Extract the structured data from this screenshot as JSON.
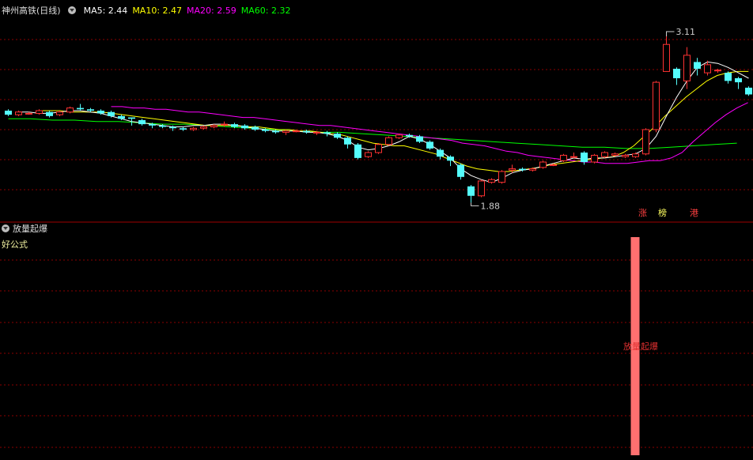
{
  "header": {
    "stock_name": "神州高铁",
    "period": "(日线)",
    "ma": [
      {
        "label": "MA5:",
        "value": "2.44",
        "color": "#ffffff"
      },
      {
        "label": "MA10:",
        "value": "2.47",
        "color": "#ffff00"
      },
      {
        "label": "MA20:",
        "value": "2.59",
        "color": "#ff00ff"
      },
      {
        "label": "MA60:",
        "value": "2.32",
        "color": "#00ff00"
      }
    ]
  },
  "tags": [
    "涨",
    "榜",
    "港"
  ],
  "indicator": {
    "name": "放量起爆",
    "formula_label": "好公式",
    "signal_text": "放量起爆"
  },
  "colors": {
    "up": "#ff3232",
    "down": "#54fcfc",
    "ma5": "#ffffff",
    "ma10": "#ffff00",
    "ma20": "#ff00ff",
    "ma60": "#00ff00",
    "grid": "#8b0000",
    "signal_bar": "#ff7070"
  },
  "chart_data": {
    "type": "candlestick",
    "high_label": "3.11",
    "low_label": "1.88",
    "y_range": [
      1.8,
      3.25
    ],
    "candles": [
      [
        2.56,
        2.53,
        2.57,
        2.52
      ],
      [
        2.53,
        2.55,
        2.56,
        2.52
      ],
      [
        2.54,
        2.54,
        2.55,
        2.53
      ],
      [
        2.54,
        2.56,
        2.57,
        2.53
      ],
      [
        2.55,
        2.52,
        2.56,
        2.51
      ],
      [
        2.53,
        2.55,
        2.56,
        2.52
      ],
      [
        2.55,
        2.58,
        2.59,
        2.54
      ],
      [
        2.58,
        2.57,
        2.61,
        2.56
      ],
      [
        2.57,
        2.56,
        2.58,
        2.55
      ],
      [
        2.56,
        2.54,
        2.57,
        2.53
      ],
      [
        2.55,
        2.52,
        2.56,
        2.51
      ],
      [
        2.52,
        2.5,
        2.53,
        2.49
      ],
      [
        2.51,
        2.5,
        2.51,
        2.45
      ],
      [
        2.49,
        2.46,
        2.5,
        2.45
      ],
      [
        2.46,
        2.45,
        2.47,
        2.43
      ],
      [
        2.45,
        2.44,
        2.46,
        2.43
      ],
      [
        2.44,
        2.43,
        2.45,
        2.41
      ],
      [
        2.43,
        2.42,
        2.44,
        2.41
      ],
      [
        2.42,
        2.43,
        2.44,
        2.41
      ],
      [
        2.43,
        2.44,
        2.45,
        2.42
      ],
      [
        2.44,
        2.45,
        2.46,
        2.43
      ],
      [
        2.46,
        2.46,
        2.48,
        2.44
      ],
      [
        2.46,
        2.44,
        2.47,
        2.43
      ],
      [
        2.45,
        2.43,
        2.46,
        2.42
      ],
      [
        2.44,
        2.42,
        2.45,
        2.41
      ],
      [
        2.42,
        2.41,
        2.43,
        2.4
      ],
      [
        2.41,
        2.4,
        2.42,
        2.39
      ],
      [
        2.4,
        2.41,
        2.42,
        2.38
      ],
      [
        2.41,
        2.41,
        2.42,
        2.4
      ],
      [
        2.41,
        2.4,
        2.42,
        2.39
      ],
      [
        2.4,
        2.4,
        2.41,
        2.38
      ],
      [
        2.4,
        2.39,
        2.41,
        2.37
      ],
      [
        2.39,
        2.36,
        2.4,
        2.35
      ],
      [
        2.36,
        2.31,
        2.37,
        2.28
      ],
      [
        2.31,
        2.21,
        2.32,
        2.2
      ],
      [
        2.22,
        2.25,
        2.26,
        2.21
      ],
      [
        2.25,
        2.31,
        2.32,
        2.24
      ],
      [
        2.31,
        2.36,
        2.37,
        2.3
      ],
      [
        2.36,
        2.38,
        2.39,
        2.35
      ],
      [
        2.38,
        2.37,
        2.39,
        2.36
      ],
      [
        2.37,
        2.33,
        2.38,
        2.32
      ],
      [
        2.33,
        2.28,
        2.34,
        2.27
      ],
      [
        2.27,
        2.22,
        2.28,
        2.2
      ],
      [
        2.22,
        2.19,
        2.23,
        2.15
      ],
      [
        2.16,
        2.07,
        2.17,
        2.05
      ],
      [
        2.0,
        1.93,
        2.01,
        1.88
      ],
      [
        1.93,
        2.04,
        2.05,
        1.92
      ],
      [
        2.03,
        2.05,
        2.06,
        2.02
      ],
      [
        2.03,
        2.11,
        2.12,
        2.02
      ],
      [
        2.12,
        2.13,
        2.16,
        2.1
      ],
      [
        2.13,
        2.12,
        2.14,
        2.11
      ],
      [
        2.12,
        2.13,
        2.14,
        2.11
      ],
      [
        2.14,
        2.18,
        2.19,
        2.13
      ],
      [
        2.16,
        2.16,
        2.17,
        2.15
      ],
      [
        2.19,
        2.23,
        2.24,
        2.18
      ],
      [
        2.22,
        2.22,
        2.25,
        2.21
      ],
      [
        2.25,
        2.18,
        2.26,
        2.16
      ],
      [
        2.18,
        2.23,
        2.24,
        2.17
      ],
      [
        2.22,
        2.25,
        2.26,
        2.21
      ],
      [
        2.23,
        2.24,
        2.25,
        2.22
      ],
      [
        2.22,
        2.23,
        2.24,
        2.21
      ],
      [
        2.22,
        2.24,
        2.25,
        2.21
      ],
      [
        2.24,
        2.42,
        2.43,
        2.23
      ],
      [
        2.42,
        2.77,
        2.78,
        2.4
      ],
      [
        2.85,
        3.05,
        3.11,
        2.85
      ],
      [
        2.87,
        2.8,
        2.88,
        2.75
      ],
      [
        2.78,
        2.97,
        3.03,
        2.72
      ],
      [
        2.92,
        2.87,
        2.95,
        2.82
      ],
      [
        2.84,
        2.9,
        2.93,
        2.82
      ],
      [
        2.86,
        2.86,
        2.87,
        2.84
      ],
      [
        2.84,
        2.78,
        2.85,
        2.76
      ],
      [
        2.8,
        2.77,
        2.81,
        2.72
      ],
      [
        2.73,
        2.68,
        2.74,
        2.67
      ]
    ],
    "ma5": [
      2.55,
      2.55,
      2.54,
      2.54,
      2.55,
      2.56,
      2.56,
      2.55,
      2.54,
      2.52,
      2.5,
      2.48,
      2.47,
      2.46,
      2.45,
      2.44,
      2.44,
      2.45,
      2.45,
      2.46,
      2.46,
      2.45,
      2.44,
      2.43,
      2.42,
      2.41,
      2.41,
      2.41,
      2.4,
      2.4,
      2.39,
      2.37,
      2.34,
      2.29,
      2.27,
      2.28,
      2.3,
      2.33,
      2.37,
      2.35,
      2.31,
      2.26,
      2.21,
      2.13,
      2.08,
      2.05,
      2.03,
      2.06,
      2.1,
      2.12,
      2.13,
      2.15,
      2.17,
      2.19,
      2.21,
      2.2,
      2.21,
      2.21,
      2.22,
      2.23,
      2.24,
      2.28,
      2.37,
      2.52,
      2.66,
      2.78,
      2.88,
      2.92,
      2.91,
      2.88,
      2.84,
      2.8
    ],
    "ma10": [
      2.56,
      2.56,
      2.56,
      2.55,
      2.55,
      2.55,
      2.55,
      2.54,
      2.53,
      2.52,
      2.51,
      2.5,
      2.49,
      2.48,
      2.47,
      2.46,
      2.45,
      2.45,
      2.45,
      2.45,
      2.44,
      2.44,
      2.43,
      2.42,
      2.42,
      2.41,
      2.41,
      2.4,
      2.39,
      2.38,
      2.36,
      2.34,
      2.32,
      2.31,
      2.3,
      2.3,
      2.28,
      2.26,
      2.24,
      2.21,
      2.18,
      2.15,
      2.13,
      2.12,
      2.11,
      2.11,
      2.12,
      2.13,
      2.14,
      2.16,
      2.17,
      2.18,
      2.19,
      2.2,
      2.21,
      2.22,
      2.25,
      2.3,
      2.37,
      2.44,
      2.52,
      2.59,
      2.66,
      2.72,
      2.78,
      2.82,
      2.84,
      2.85,
      2.85
    ],
    "ma20": [
      2.59,
      2.59,
      2.58,
      2.58,
      2.57,
      2.57,
      2.56,
      2.55,
      2.55,
      2.54,
      2.53,
      2.52,
      2.51,
      2.51,
      2.5,
      2.49,
      2.48,
      2.47,
      2.46,
      2.45,
      2.45,
      2.44,
      2.43,
      2.42,
      2.41,
      2.4,
      2.39,
      2.38,
      2.37,
      2.36,
      2.35,
      2.34,
      2.32,
      2.31,
      2.3,
      2.28,
      2.26,
      2.25,
      2.23,
      2.22,
      2.21,
      2.2,
      2.19,
      2.18,
      2.18,
      2.17,
      2.17,
      2.17,
      2.18,
      2.19,
      2.19,
      2.21,
      2.25,
      2.33,
      2.4,
      2.47,
      2.53,
      2.58,
      2.62
    ],
    "ma60": [
      2.5,
      2.5,
      2.49,
      2.49,
      2.48,
      2.48,
      2.47,
      2.46,
      2.46,
      2.45,
      2.44,
      2.43,
      2.42,
      2.41,
      2.4,
      2.4,
      2.39,
      2.38,
      2.37,
      2.36,
      2.35,
      2.34,
      2.33,
      2.32,
      2.31,
      2.3,
      2.29,
      2.29,
      2.28,
      2.28,
      2.29,
      2.3,
      2.31,
      2.32
    ]
  }
}
